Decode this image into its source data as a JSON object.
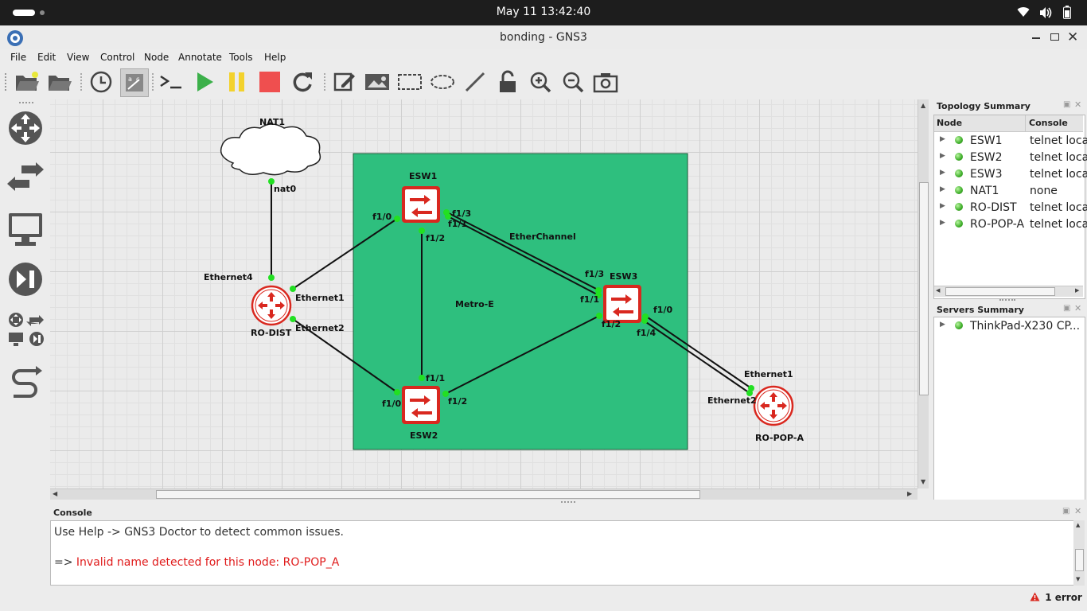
{
  "system": {
    "datetime": "May 11  13:42:40"
  },
  "window": {
    "title": "bonding - GNS3"
  },
  "menu": [
    "File",
    "Edit",
    "View",
    "Control",
    "Node",
    "Annotate",
    "Tools",
    "Help"
  ],
  "toolbar": [
    "open-project-icon",
    "open-folder-icon",
    "snapshot-clock-icon",
    "show-interface-labels-icon",
    "console-all-icon",
    "start-all-icon",
    "suspend-all-icon",
    "stop-all-icon",
    "reload-all-icon",
    "add-note-icon",
    "insert-picture-icon",
    "draw-rectangle-icon",
    "draw-ellipse-icon",
    "draw-line-icon",
    "lock-items-icon",
    "zoom-in-icon",
    "zoom-out-icon",
    "screenshot-icon"
  ],
  "topology": {
    "area_label": "Metro-E",
    "etherchannel_label": "EtherChannel",
    "nodes": {
      "nat1": "NAT1",
      "esw1": "ESW1",
      "esw2": "ESW2",
      "esw3": "ESW3",
      "rodist": "RO-DIST",
      "ropopa": "RO-POP-A"
    },
    "ports": {
      "nat0": "nat0",
      "eth4": "Ethernet4",
      "rd_eth1": "Ethernet1",
      "rd_eth2": "Ethernet2",
      "e1_f10": "f1/0",
      "e1_f13": "f1/3",
      "e1_f11": "f1/1",
      "e1_f12": "f1/2",
      "e3_f13": "f1/3",
      "e3_f11": "f1/1",
      "e3_f12": "f1/2",
      "e3_f10": "f1/0",
      "e3_f14": "f1/4",
      "e2_f11": "f1/1",
      "e2_f10": "f1/0",
      "e2_f12": "f1/2",
      "rp_eth1": "Ethernet1",
      "rp_eth2": "Ethernet2"
    }
  },
  "topology_summary": {
    "title": "Topology Summary",
    "col_node": "Node",
    "col_console": "Console",
    "rows": [
      {
        "node": "ESW1",
        "console": "telnet loca"
      },
      {
        "node": "ESW2",
        "console": "telnet loca"
      },
      {
        "node": "ESW3",
        "console": "telnet loca"
      },
      {
        "node": "NAT1",
        "console": "none"
      },
      {
        "node": "RO-DIST",
        "console": "telnet loca"
      },
      {
        "node": "RO-POP-A",
        "console": "telnet loca"
      }
    ]
  },
  "servers_summary": {
    "title": "Servers Summary",
    "server": "ThinkPad-X230 CP..."
  },
  "console": {
    "title": "Console",
    "line1": "Use Help -> GNS3 Doctor to detect common issues.",
    "prompt": "=> ",
    "error_line": "Invalid name detected for this node: RO-POP_A"
  },
  "status": {
    "errors": "1 error"
  },
  "colors": {
    "metro_area": "#2ebf7e",
    "router_red": "#d9281f",
    "error_red": "#e01b1b",
    "link_dot": "#22e022"
  }
}
